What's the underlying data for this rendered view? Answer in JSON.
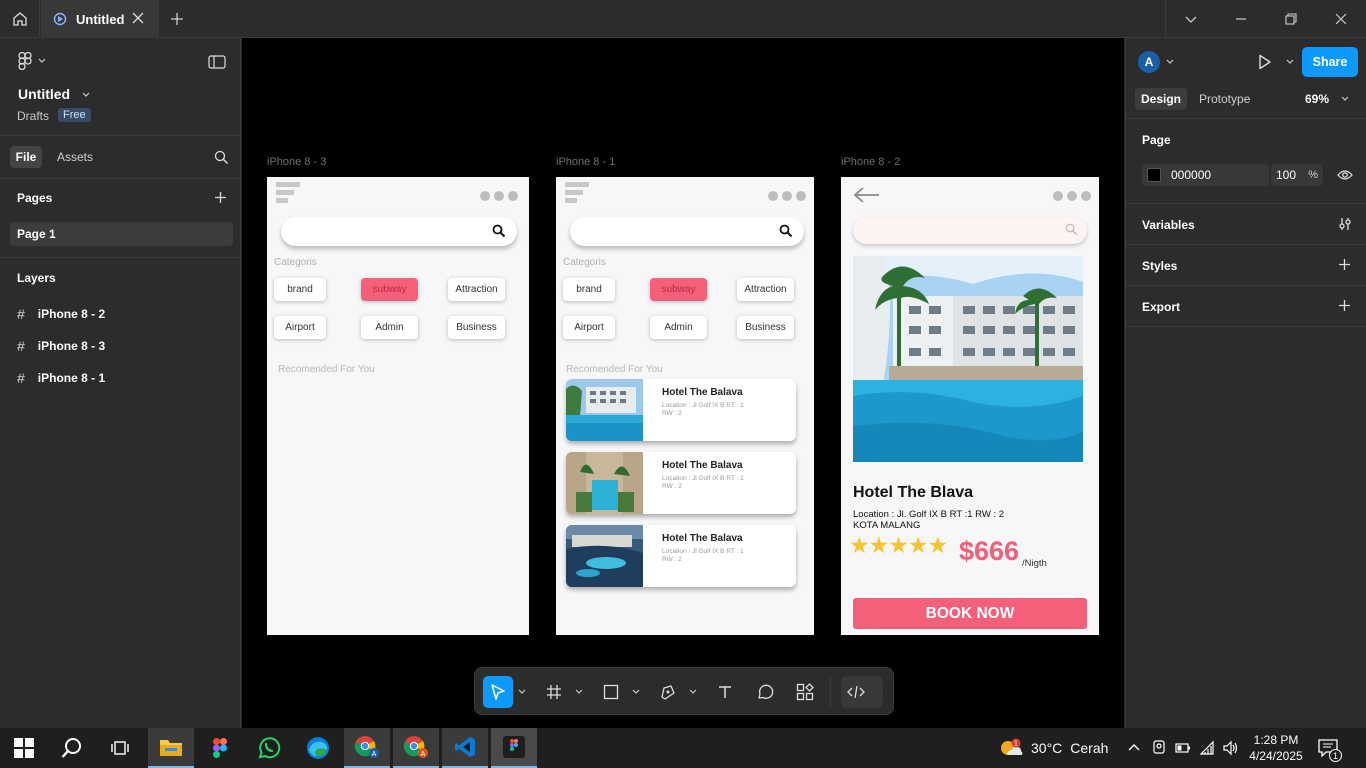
{
  "titlebar": {
    "tab_title": "Untitled",
    "controls": [
      "chevron-down-icon",
      "minimize-icon",
      "restore-icon",
      "close-icon"
    ]
  },
  "left_panel": {
    "file_name": "Untitled",
    "drafts": "Drafts",
    "plan_badge": "Free",
    "tabs": [
      "File",
      "Assets"
    ],
    "pages_heading": "Pages",
    "pages": [
      "Page 1"
    ],
    "layers_heading": "Layers",
    "layers": [
      "iPhone 8 - 2",
      "iPhone 8 - 3",
      "iPhone 8 - 1"
    ]
  },
  "canvas": {
    "background": "#000000",
    "frames": [
      {
        "label": "iPhone 8 - 3",
        "categories_label": "Categoris",
        "chips": [
          "brand",
          "subway",
          "Attraction",
          "Airport",
          "Admin",
          "Business"
        ],
        "active_chip": "subway",
        "recommended_label": "Recomended For You"
      },
      {
        "label": "iPhone 8 - 1",
        "categories_label": "Categoris",
        "chips": [
          "brand",
          "subway",
          "Attraction",
          "Airport",
          "Admin",
          "Business"
        ],
        "active_chip": "subway",
        "recommended_label": "Recomended For You",
        "hotels": [
          {
            "name": "Hotel The Balava",
            "loc1": "Location : Jl Golf IX B RT : 1",
            "loc2": "RW : 2"
          },
          {
            "name": "Hotel The Balava",
            "loc1": "Location : Jl Golf IX B RT : 1",
            "loc2": "RW : 2"
          },
          {
            "name": "Hotel The Balava",
            "loc1": "Location : Jl Golf IX B RT : 1",
            "loc2": "RW : 2"
          }
        ]
      },
      {
        "label": "iPhone 8 - 2",
        "hotel_name": "Hotel The Blava",
        "location": "Location : Jl. Golf IX B RT :1 RW : 2",
        "city": "KOTA MALANG",
        "rating_stars": "★★★★★",
        "price": "$666",
        "price_unit": "/Nigth",
        "book_button": "BOOK NOW"
      }
    ]
  },
  "right_panel": {
    "avatar_letter": "A",
    "share_label": "Share",
    "tabs": [
      "Design",
      "Prototype"
    ],
    "zoom": "69%",
    "page_heading": "Page",
    "page_color_hex": "000000",
    "page_opacity": "100",
    "percent_sign": "%",
    "sections": [
      "Variables",
      "Styles",
      "Export"
    ]
  },
  "taskbar": {
    "temperature": "30°C",
    "weather": "Cerah",
    "time": "1:28 PM",
    "date": "4/24/2025",
    "notification_count": "1"
  },
  "colors": {
    "accent_pink": "#f4607a",
    "share_blue": "#0d99ff",
    "star_yellow": "#f6c431"
  }
}
